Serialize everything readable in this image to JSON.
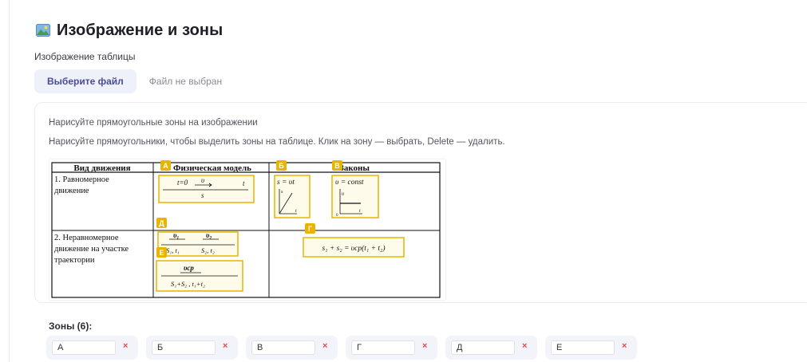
{
  "header": {
    "icon": "image-icon",
    "title": "Изображение и зоны"
  },
  "image_field": {
    "label": "Изображение таблицы",
    "button_label": "Выберите файл",
    "file_status": "Файл не выбран"
  },
  "editor": {
    "hint_title": "Нарисуйте прямоугольные зоны на изображении",
    "hint_text": "Нарисуйте прямоугольники, чтобы выделить зоны на таблице. Клик на зону — выбрать, Delete — удалить.",
    "table": {
      "headers": [
        "Вид движения",
        "Физическая модель",
        "Законы"
      ],
      "row1_label": [
        "1. Равномерное",
        "движение"
      ],
      "row2_label": [
        "2. Неравномерное",
        "движение на участке",
        "траектории"
      ],
      "formula_s_vt": "s = υt",
      "formula_v_const": "υ = const",
      "formula_sum": "s₁ + s₂ = υср(t₁ + t₂)",
      "model1_t0": "t=0",
      "model1_v": "υ",
      "model1_t": "t",
      "model1_s": "s",
      "model2_v1": "υ₁",
      "model2_v2": "υ₂",
      "model2_s1t1": "S₁, t₁",
      "model2_s2t2": "S₂, t₂",
      "model3_vcp": "υср",
      "model3_sum": "S₁+S₂ , t₁+t₂",
      "graph_s": "s",
      "graph_t": "t",
      "graph_v": "υ",
      "graph_origin": "0"
    },
    "zone_tags": [
      "А",
      "Б",
      "В",
      "Г",
      "Д",
      "Е"
    ],
    "zone_color": "#e8b400"
  },
  "zones": {
    "title": "Зоны (6):",
    "items": [
      {
        "value": "А"
      },
      {
        "value": "Б"
      },
      {
        "value": "В"
      },
      {
        "value": "Г"
      },
      {
        "value": "Д"
      },
      {
        "value": "Е"
      }
    ],
    "remove_glyph": "×"
  }
}
